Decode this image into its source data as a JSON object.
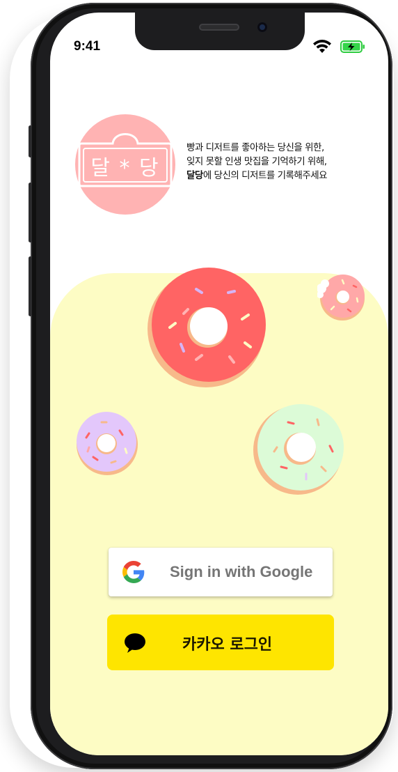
{
  "status_bar": {
    "time": "9:41",
    "wifi_icon": "wifi-icon",
    "battery_icon": "battery-charging-icon"
  },
  "logo": {
    "text": "달 * 당",
    "background": "#ffb3b3"
  },
  "tagline": {
    "line1": "빵과 디저트를 좋아하는 당신을 위한,",
    "line2": "잊지 못할 인생 맛집을 기억하기 위해,",
    "line3_bold": "달당",
    "line3_rest": "에 당신의 디저트를 기록해주세요"
  },
  "google_button": {
    "label": "Sign in with Google",
    "icon": "google-logo-icon"
  },
  "kakao_button": {
    "label": "카카오 로그인",
    "icon": "speech-bubble-icon",
    "background": "#fee500"
  },
  "colors": {
    "accent_yellow_bg": "#fdfcc4",
    "donut_red": "#ff6464",
    "donut_pink": "#ffa8a8",
    "donut_purple": "#e3c7fb",
    "donut_green": "#dcfbd7",
    "donut_base": "#f7b98a"
  }
}
